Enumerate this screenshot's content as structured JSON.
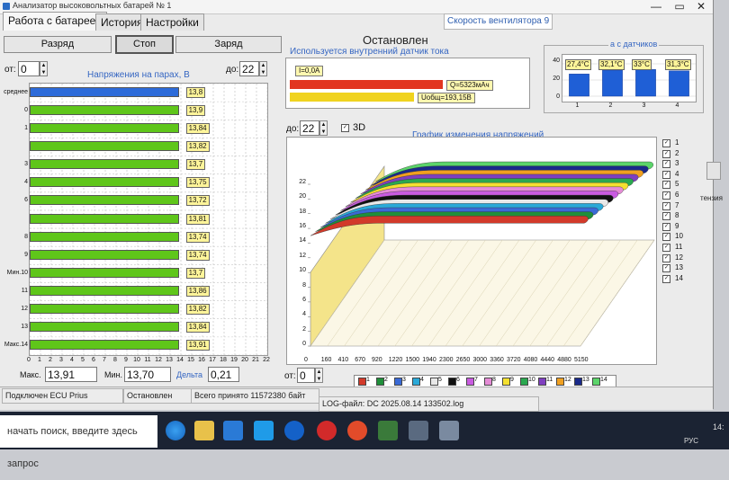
{
  "window": {
    "title": "Анализатор высоковольтных батарей № 1",
    "minimize": "—",
    "restore": "▭",
    "close": "✕"
  },
  "tabs": [
    "Работа с батареей",
    "История",
    "Настройки"
  ],
  "fan_speed_label": "Скорость вентилятора 9",
  "buttons": {
    "discharge": "Разряд",
    "stop": "Стоп",
    "charge": "Заряд"
  },
  "state_text": "Остановлен",
  "sensor_notice": "Используется внутренний датчик тока",
  "left_chart": {
    "from_label": "от:",
    "from_value": "0",
    "to_label": "до:",
    "to_value": "22",
    "title": "Напряжения на парах, В",
    "x_ticks": [
      "0",
      "1",
      "2",
      "3",
      "4",
      "5",
      "6",
      "7",
      "8",
      "9",
      "10",
      "11",
      "12",
      "13",
      "14",
      "15",
      "16",
      "17",
      "18",
      "19",
      "20",
      "21",
      "22"
    ],
    "rows": [
      {
        "label": "среднее",
        "value": "13,8",
        "color": "#2d6bd9"
      },
      {
        "label": "0",
        "value": "13,9",
        "color": "#5fc61a"
      },
      {
        "label": "1",
        "value": "13,84",
        "color": "#5fc61a"
      },
      {
        "label": "",
        "value": "13,82",
        "color": "#5fc61a"
      },
      {
        "label": "3",
        "value": "13,7",
        "color": "#5fc61a"
      },
      {
        "label": "4",
        "value": "13,75",
        "color": "#5fc61a"
      },
      {
        "label": "6",
        "value": "13,72",
        "color": "#5fc61a"
      },
      {
        "label": "",
        "value": "13,81",
        "color": "#5fc61a"
      },
      {
        "label": "8",
        "value": "13,74",
        "color": "#5fc61a"
      },
      {
        "label": "9",
        "value": "13,74",
        "color": "#5fc61a"
      },
      {
        "label": "Мин.10",
        "value": "13,7",
        "color": "#5fc61a"
      },
      {
        "label": "11",
        "value": "13,86",
        "color": "#5fc61a"
      },
      {
        "label": "12",
        "value": "13,82",
        "color": "#5fc61a"
      },
      {
        "label": "13",
        "value": "13,84",
        "color": "#5fc61a"
      },
      {
        "label": "Макс.14",
        "value": "13,91",
        "color": "#5fc61a"
      }
    ],
    "bar_extent": 13.8,
    "stats": {
      "max_label": "Макс.",
      "max_value": "13,91",
      "min_label": "Мин.",
      "min_value": "13,70",
      "delta_label": "Дельта",
      "delta_value": "0,21"
    }
  },
  "current": {
    "i_label": "I=0,0A",
    "q_label": "Q=5323мАч",
    "u_label": "Uобщ=193,15В"
  },
  "sensors": {
    "title": "а с датчиков",
    "labels": [
      "27,4°C",
      "32,1°C",
      "33°C",
      "31,3°C"
    ],
    "values": [
      27.4,
      32.1,
      33,
      31.3
    ],
    "y_ticks": [
      "40",
      "20",
      "0"
    ],
    "x_ticks": [
      "1",
      "2",
      "3",
      "4"
    ]
  },
  "chart3d": {
    "to_label": "до:",
    "to_value": "22",
    "check3d": "3D",
    "title": "График изменения напряжений",
    "y_ticks": [
      "22",
      "20",
      "18",
      "16",
      "14",
      "12",
      "10",
      "8",
      "6",
      "4",
      "2",
      "0"
    ],
    "x_ticks": [
      "0",
      "160",
      "410",
      "670",
      "920",
      "1220",
      "1500",
      "1940",
      "2300",
      "2650",
      "3000",
      "3360",
      "3720",
      "4080",
      "4440",
      "4880",
      "5150"
    ],
    "from_label": "от:",
    "from_value": "0",
    "legend": [
      "1",
      "2",
      "3",
      "4",
      "5",
      "6",
      "7",
      "8",
      "9",
      "10",
      "11",
      "12",
      "13",
      "14"
    ],
    "series_colors": [
      "#d23a2a",
      "#1f8f3a",
      "#3a6ad6",
      "#2aa9d8",
      "#e8e8e8",
      "#111111",
      "#c95be0",
      "#e58cd6",
      "#f4e030",
      "#2aa84f",
      "#7f3fbf",
      "#f0a020",
      "#1a2a8a",
      "#5bd46a"
    ]
  },
  "statusbar": {
    "ecu": "Подключен ECU Prius",
    "state": "Остановлен",
    "bytes": "Всего принято 11572380 байт",
    "log": "LOG-файл: DC 2025.08.14 133502.log"
  },
  "taskbar": {
    "search_placeholder": "начать поиск, введите здесь запрос",
    "lang": "РУС",
    "clock": "14:"
  },
  "desktop": {
    "side_text": "тензия"
  }
}
